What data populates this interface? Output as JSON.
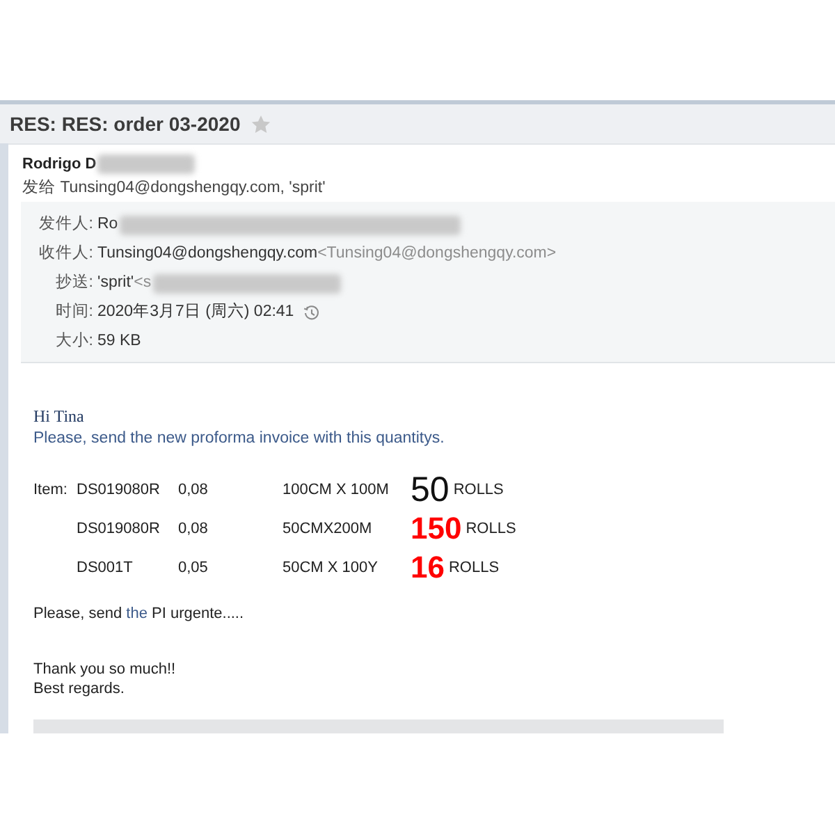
{
  "subject": {
    "text": "RES: RES: order 03-2020",
    "starred": false
  },
  "sender": {
    "name": "Rodrigo D",
    "blurred": true
  },
  "recipients_line": {
    "label": "发给",
    "value": "Tunsing04@dongshengqy.com, 'sprit'"
  },
  "details": [
    {
      "kind": "text",
      "label": "发件人:",
      "value": "Ro",
      "blurred": true
    },
    {
      "kind": "text",
      "label": "收件人:",
      "value": "Tunsing04@dongshengqy.com",
      "detail": "<Tunsing04@dongshengqy.com>",
      "blurred": false
    },
    {
      "kind": "text",
      "label": "抄送:",
      "value": "'sprit'",
      "detail": "<s",
      "blurred": true
    },
    {
      "kind": "time",
      "label": "时间:",
      "value": "2020年3月7日 (周六) 02:41",
      "blurred": false
    },
    {
      "kind": "text",
      "label": "大小:",
      "value": "59 KB",
      "blurred": false
    }
  ],
  "greeting": "Hi Tina",
  "intro": "Please, send the new proforma invoice with this quantitys.",
  "items": [
    {
      "label": "Item:",
      "code": "DS019080R",
      "value": "0,08",
      "size": "100CM X 100M",
      "quantity": "50",
      "unit": "ROLLS",
      "highlighted": false
    },
    {
      "code": "DS019080R",
      "value": "0,08",
      "size": "50CMX200M",
      "quantity": "150",
      "unit": "ROLLS",
      "highlighted": true
    },
    {
      "code": "DS001T",
      "value": "0,05",
      "size": "50CM X 100Y",
      "quantity": "16",
      "unit": "ROLLS",
      "highlighted": true
    }
  ],
  "closing": [
    {
      "text": "Please, send ",
      "kind": "plain"
    },
    {
      "text": "the",
      "kind": "accent"
    },
    {
      "text": " PI urgente.....",
      "kind": "plain"
    }
  ],
  "sign_off": [
    "Thank you so much!!",
    "Best regards."
  ]
}
